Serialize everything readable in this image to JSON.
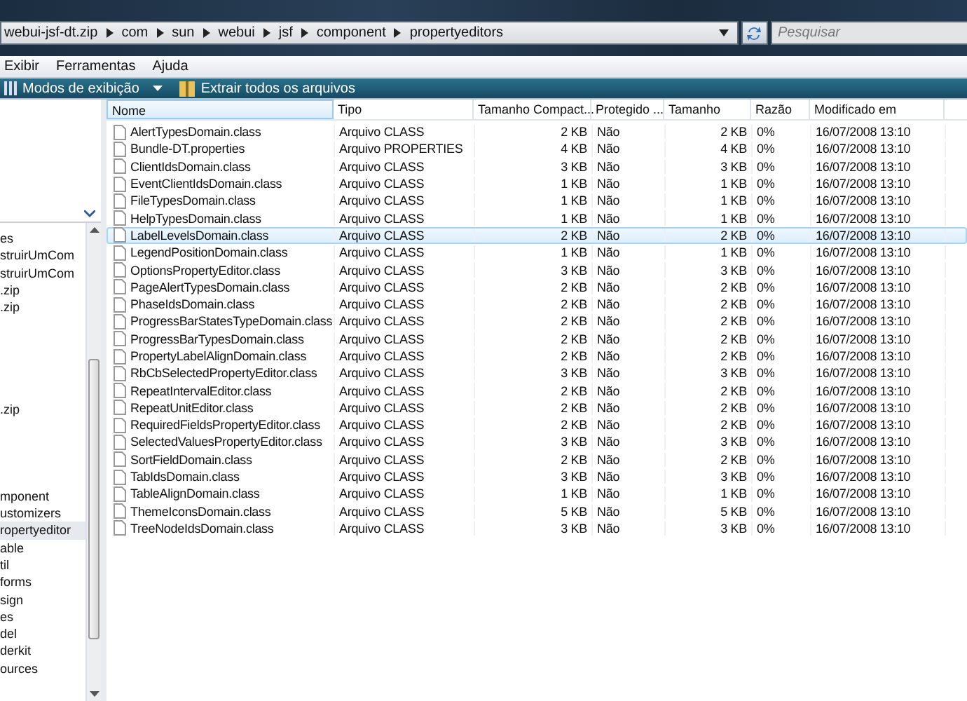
{
  "address_bar": {
    "crumbs": [
      "webui-jsf-dt.zip",
      "com",
      "sun",
      "webui",
      "jsf",
      "component",
      "propertyeditors"
    ]
  },
  "search": {
    "placeholder": "Pesquisar"
  },
  "menu": [
    "Exibir",
    "Ferramentas",
    "Ajuda"
  ],
  "toolbar": [
    {
      "kind": "views",
      "label": "Modos de exibição"
    },
    {
      "kind": "extract",
      "label": "Extrair todos os arquivos"
    }
  ],
  "nav_tree": [
    [
      "es",
      "struirUmCom",
      "struirUmCom",
      ".zip",
      ".zip"
    ],
    [
      ".zip"
    ],
    [
      {
        "label": "mponent",
        "selected": false
      },
      {
        "label": "ustomizers",
        "selected": false
      },
      {
        "label": "ropertyeditor",
        "selected": true
      },
      {
        "label": "able",
        "selected": false
      },
      {
        "label": "til",
        "selected": false
      },
      {
        "label": "forms",
        "selected": false
      },
      {
        "label": "sign",
        "selected": false
      },
      {
        "label": "es",
        "selected": false
      },
      {
        "label": "del",
        "selected": false
      },
      {
        "label": "derkit",
        "selected": false
      },
      {
        "label": "ources",
        "selected": false
      }
    ]
  ],
  "table": {
    "columns": [
      "Nome",
      "Tipo",
      "Tamanho Compact...",
      "Protegido ...",
      "Tamanho",
      "Razão",
      "Modificado em"
    ],
    "rows": [
      {
        "name": "AlertTypesDomain.class",
        "type": "Arquivo CLASS",
        "packed": "2 KB",
        "protected": "Não",
        "size": "2 KB",
        "ratio": "0%",
        "modified": "16/07/2008 13:10",
        "selected": false
      },
      {
        "name": "Bundle-DT.properties",
        "type": "Arquivo PROPERTIES",
        "packed": "4 KB",
        "protected": "Não",
        "size": "4 KB",
        "ratio": "0%",
        "modified": "16/07/2008 13:10",
        "selected": false
      },
      {
        "name": "ClientIdsDomain.class",
        "type": "Arquivo CLASS",
        "packed": "3 KB",
        "protected": "Não",
        "size": "3 KB",
        "ratio": "0%",
        "modified": "16/07/2008 13:10",
        "selected": false
      },
      {
        "name": "EventClientIdsDomain.class",
        "type": "Arquivo CLASS",
        "packed": "1 KB",
        "protected": "Não",
        "size": "1 KB",
        "ratio": "0%",
        "modified": "16/07/2008 13:10",
        "selected": false
      },
      {
        "name": "FileTypesDomain.class",
        "type": "Arquivo CLASS",
        "packed": "1 KB",
        "protected": "Não",
        "size": "1 KB",
        "ratio": "0%",
        "modified": "16/07/2008 13:10",
        "selected": false
      },
      {
        "name": "HelpTypesDomain.class",
        "type": "Arquivo CLASS",
        "packed": "1 KB",
        "protected": "Não",
        "size": "1 KB",
        "ratio": "0%",
        "modified": "16/07/2008 13:10",
        "selected": false
      },
      {
        "name": "LabelLevelsDomain.class",
        "type": "Arquivo CLASS",
        "packed": "2 KB",
        "protected": "Não",
        "size": "2 KB",
        "ratio": "0%",
        "modified": "16/07/2008 13:10",
        "selected": true
      },
      {
        "name": "LegendPositionDomain.class",
        "type": "Arquivo CLASS",
        "packed": "1 KB",
        "protected": "Não",
        "size": "1 KB",
        "ratio": "0%",
        "modified": "16/07/2008 13:10",
        "selected": false
      },
      {
        "name": "OptionsPropertyEditor.class",
        "type": "Arquivo CLASS",
        "packed": "3 KB",
        "protected": "Não",
        "size": "3 KB",
        "ratio": "0%",
        "modified": "16/07/2008 13:10",
        "selected": false
      },
      {
        "name": "PageAlertTypesDomain.class",
        "type": "Arquivo CLASS",
        "packed": "2 KB",
        "protected": "Não",
        "size": "2 KB",
        "ratio": "0%",
        "modified": "16/07/2008 13:10",
        "selected": false
      },
      {
        "name": "PhaseIdsDomain.class",
        "type": "Arquivo CLASS",
        "packed": "2 KB",
        "protected": "Não",
        "size": "2 KB",
        "ratio": "0%",
        "modified": "16/07/2008 13:10",
        "selected": false
      },
      {
        "name": "ProgressBarStatesTypeDomain.class",
        "type": "Arquivo CLASS",
        "packed": "2 KB",
        "protected": "Não",
        "size": "2 KB",
        "ratio": "0%",
        "modified": "16/07/2008 13:10",
        "selected": false
      },
      {
        "name": "ProgressBarTypesDomain.class",
        "type": "Arquivo CLASS",
        "packed": "2 KB",
        "protected": "Não",
        "size": "2 KB",
        "ratio": "0%",
        "modified": "16/07/2008 13:10",
        "selected": false
      },
      {
        "name": "PropertyLabelAlignDomain.class",
        "type": "Arquivo CLASS",
        "packed": "2 KB",
        "protected": "Não",
        "size": "2 KB",
        "ratio": "0%",
        "modified": "16/07/2008 13:10",
        "selected": false
      },
      {
        "name": "RbCbSelectedPropertyEditor.class",
        "type": "Arquivo CLASS",
        "packed": "3 KB",
        "protected": "Não",
        "size": "3 KB",
        "ratio": "0%",
        "modified": "16/07/2008 13:10",
        "selected": false
      },
      {
        "name": "RepeatIntervalEditor.class",
        "type": "Arquivo CLASS",
        "packed": "2 KB",
        "protected": "Não",
        "size": "2 KB",
        "ratio": "0%",
        "modified": "16/07/2008 13:10",
        "selected": false
      },
      {
        "name": "RepeatUnitEditor.class",
        "type": "Arquivo CLASS",
        "packed": "2 KB",
        "protected": "Não",
        "size": "2 KB",
        "ratio": "0%",
        "modified": "16/07/2008 13:10",
        "selected": false
      },
      {
        "name": "RequiredFieldsPropertyEditor.class",
        "type": "Arquivo CLASS",
        "packed": "2 KB",
        "protected": "Não",
        "size": "2 KB",
        "ratio": "0%",
        "modified": "16/07/2008 13:10",
        "selected": false
      },
      {
        "name": "SelectedValuesPropertyEditor.class",
        "type": "Arquivo CLASS",
        "packed": "3 KB",
        "protected": "Não",
        "size": "3 KB",
        "ratio": "0%",
        "modified": "16/07/2008 13:10",
        "selected": false
      },
      {
        "name": "SortFieldDomain.class",
        "type": "Arquivo CLASS",
        "packed": "2 KB",
        "protected": "Não",
        "size": "2 KB",
        "ratio": "0%",
        "modified": "16/07/2008 13:10",
        "selected": false
      },
      {
        "name": "TabIdsDomain.class",
        "type": "Arquivo CLASS",
        "packed": "3 KB",
        "protected": "Não",
        "size": "3 KB",
        "ratio": "0%",
        "modified": "16/07/2008 13:10",
        "selected": false
      },
      {
        "name": "TableAlignDomain.class",
        "type": "Arquivo CLASS",
        "packed": "1 KB",
        "protected": "Não",
        "size": "1 KB",
        "ratio": "0%",
        "modified": "16/07/2008 13:10",
        "selected": false
      },
      {
        "name": "ThemeIconsDomain.class",
        "type": "Arquivo CLASS",
        "packed": "5 KB",
        "protected": "Não",
        "size": "5 KB",
        "ratio": "0%",
        "modified": "16/07/2008 13:10",
        "selected": false
      },
      {
        "name": "TreeNodeIdsDomain.class",
        "type": "Arquivo CLASS",
        "packed": "3 KB",
        "protected": "Não",
        "size": "3 KB",
        "ratio": "0%",
        "modified": "16/07/2008 13:10",
        "selected": false
      }
    ]
  }
}
